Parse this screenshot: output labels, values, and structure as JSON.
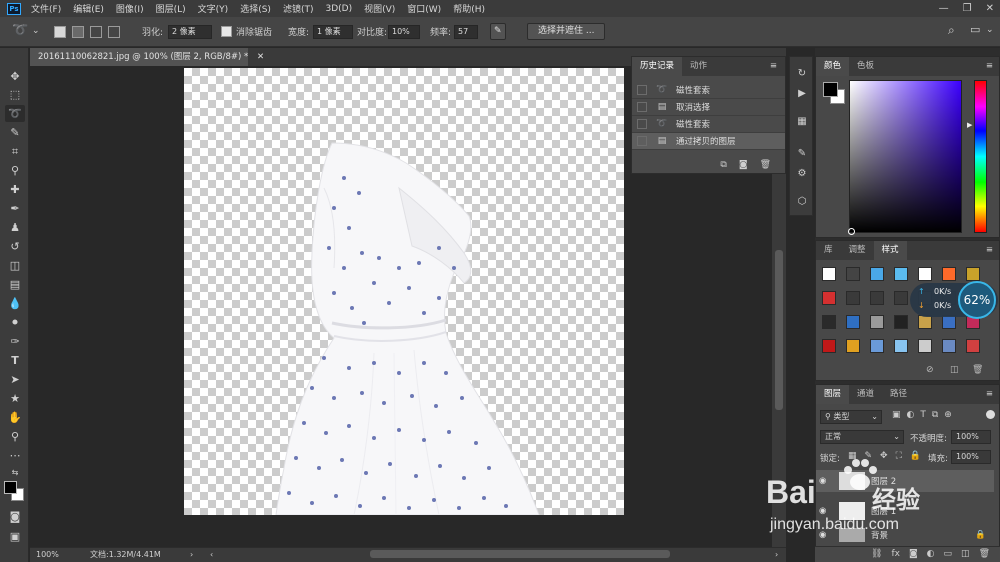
{
  "app": {
    "logo": "Ps"
  },
  "menu": [
    "文件(F)",
    "编辑(E)",
    "图像(I)",
    "图层(L)",
    "文字(Y)",
    "选择(S)",
    "滤镜(T)",
    "3D(D)",
    "视图(V)",
    "窗口(W)",
    "帮助(H)"
  ],
  "window_controls": {
    "minimize": "—",
    "restore": "❐",
    "close": "✕"
  },
  "options": {
    "feather_label": "羽化:",
    "feather_value": "2 像素",
    "antialias_label": "消除锯齿",
    "width_label": "宽度:",
    "width_value": "1 像素",
    "contrast_label": "对比度:",
    "contrast_value": "10%",
    "frequency_label": "频率:",
    "frequency_value": "57",
    "select_mask_button": "选择并遮住 ..."
  },
  "document": {
    "tab_title": "20161110062821.jpg @ 100% (图层 2, RGB/8#) *",
    "zoom": "100%",
    "doc_info": "文档:1.32M/4.41M"
  },
  "history": {
    "tabs": [
      "历史记录",
      "动作"
    ],
    "items": [
      {
        "label": "磁性套索",
        "icon": "lasso-icon"
      },
      {
        "label": "取消选择",
        "icon": "document-icon"
      },
      {
        "label": "磁性套索",
        "icon": "lasso-icon"
      },
      {
        "label": "通过拷贝的图层",
        "icon": "document-icon"
      }
    ]
  },
  "color_panel": {
    "tabs": [
      "颜色",
      "色板"
    ],
    "foreground": "#000000",
    "background": "#ffffff"
  },
  "styles_panel": {
    "tabs": [
      "库",
      "调整",
      "样式"
    ],
    "swatches": [
      "#ffffff",
      "#444444",
      "#4aa8e8",
      "#5bbcf0",
      "#ffffff",
      "#ff6a2a",
      "#c9a22a",
      "#d43030",
      "#3a3a3a",
      "#3a3a3a",
      "#3a3a3a",
      "#4a4a4a",
      "#3a3a3a",
      "#3a3a3a",
      "#2a2a2a",
      "#2f6fc2",
      "#9a9a9a",
      "#222222",
      "#c9a24a",
      "#3a6fc2",
      "#c22b5a",
      "#c01818",
      "#e0a020",
      "#6a9ad8",
      "#88c4f0",
      "#cccccc",
      "#6a8ac2",
      "#d04040"
    ]
  },
  "layers_panel": {
    "tabs": [
      "图层",
      "通道",
      "路径"
    ],
    "filter_label": "类型",
    "blend_mode": "正常",
    "opacity_label": "不透明度:",
    "opacity_value": "100%",
    "lock_label": "锁定:",
    "fill_label": "填充:",
    "fill_value": "100%",
    "layers": [
      {
        "name": "图层 2"
      },
      {
        "name": "图层 1"
      },
      {
        "name": "背景"
      }
    ],
    "footer_icons": [
      "link-icon",
      "fx-icon",
      "mask-icon",
      "adjustment-icon",
      "folder-icon",
      "new-layer-icon",
      "trash-icon"
    ]
  },
  "speed_widget": {
    "up": "0K/s",
    "down": "0K/s",
    "percent": "62%"
  },
  "watermark": {
    "brand": "Bai",
    "brand2": "经验",
    "url": "jingyan.baidu.com"
  }
}
